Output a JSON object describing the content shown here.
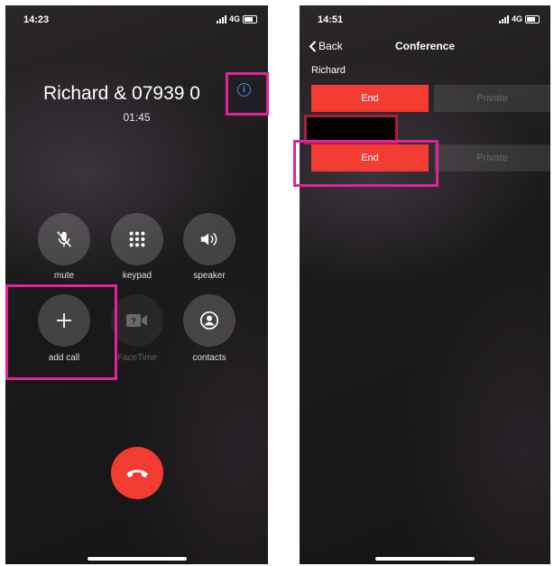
{
  "call_screen": {
    "status_time": "14:23",
    "network": "4G",
    "caller_name": "Richard & 07939 0",
    "duration": "01:45",
    "buttons": [
      {
        "label": "mute",
        "icon": "mic-muted-icon"
      },
      {
        "label": "keypad",
        "icon": "keypad-icon"
      },
      {
        "label": "speaker",
        "icon": "speaker-icon"
      },
      {
        "label": "add call",
        "icon": "plus-icon"
      },
      {
        "label": "FaceTime",
        "icon": "facetime-icon"
      },
      {
        "label": "contacts",
        "icon": "contacts-icon"
      }
    ]
  },
  "conference_screen": {
    "status_time": "14:51",
    "network": "4G",
    "back_label": "Back",
    "title": "Conference",
    "participants": [
      {
        "name": "Richard",
        "end_label": "End",
        "private_label": "Private"
      },
      {
        "name": "",
        "end_label": "End",
        "private_label": "Private"
      }
    ]
  },
  "colors": {
    "end_red": "#f23c32",
    "highlight_magenta": "#e0239b",
    "info_blue": "#3c8bff"
  }
}
